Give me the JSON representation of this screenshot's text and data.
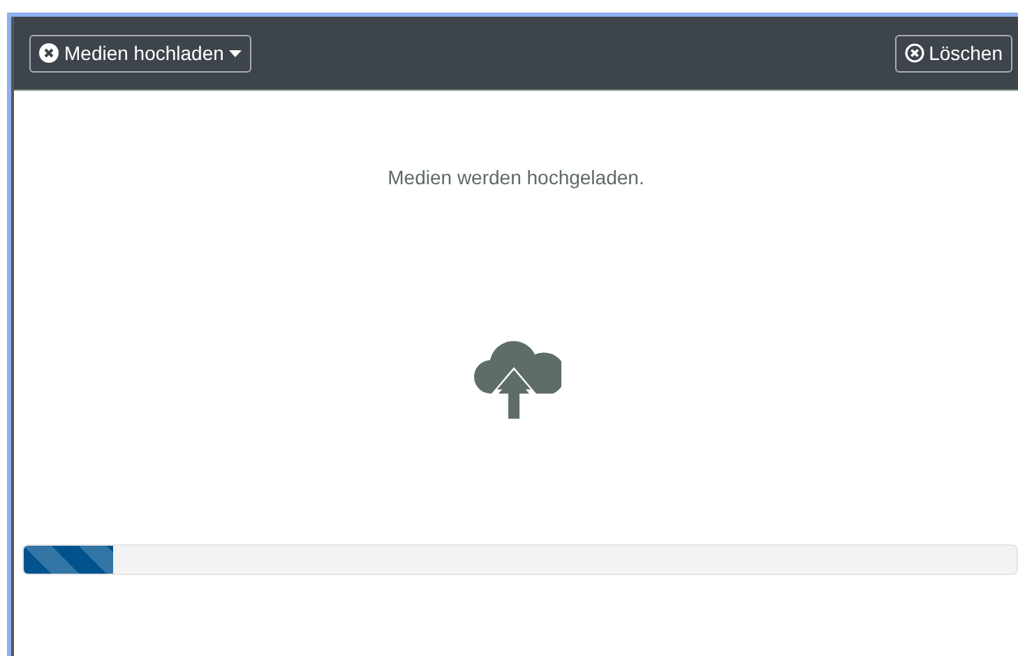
{
  "toolbar": {
    "upload_button": {
      "label": "Medien hochladen"
    },
    "delete_button": {
      "label": "Löschen"
    }
  },
  "status": {
    "message": "Medien werden hochgeladen."
  },
  "progress": {
    "level": 0.09
  }
}
